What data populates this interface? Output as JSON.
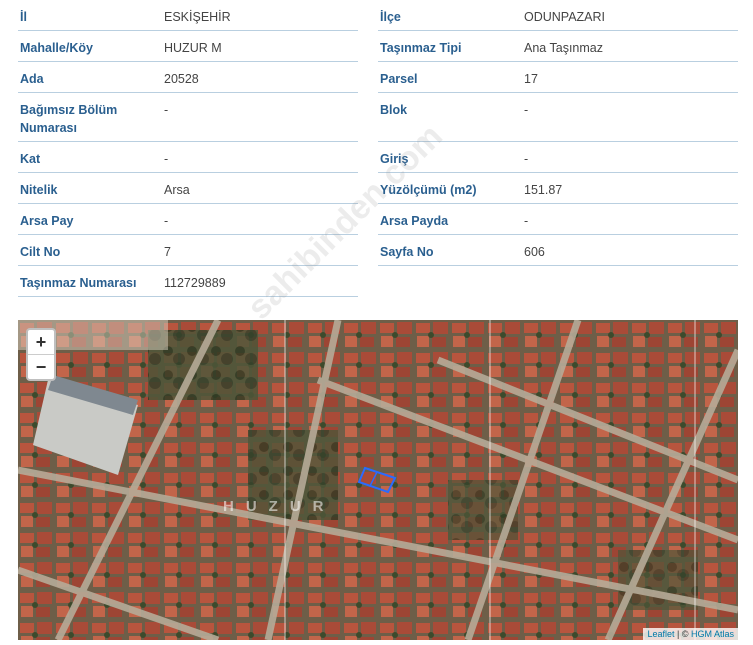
{
  "rows": [
    {
      "l1": "İl",
      "v1": "ESKİŞEHİR",
      "l2": "İlçe",
      "v2": "ODUNPAZARI"
    },
    {
      "l1": "Mahalle/Köy",
      "v1": "HUZUR M",
      "l2": "Taşınmaz Tipi",
      "v2": "Ana Taşınmaz"
    },
    {
      "l1": "Ada",
      "v1": "20528",
      "l2": "Parsel",
      "v2": "17"
    },
    {
      "l1": "Bağımsız Bölüm Numarası",
      "v1": "-",
      "l2": "Blok",
      "v2": "-"
    },
    {
      "l1": "Kat",
      "v1": "-",
      "l2": "Giriş",
      "v2": "-"
    },
    {
      "l1": "Nitelik",
      "v1": "Arsa",
      "l2": "Yüzölçümü (m2)",
      "v2": "151.87"
    },
    {
      "l1": "Arsa Pay",
      "v1": "-",
      "l2": "Arsa Payda",
      "v2": "-"
    },
    {
      "l1": "Cilt No",
      "v1": "7",
      "l2": "Sayfa No",
      "v2": "606"
    },
    {
      "l1": "Taşınmaz Numarası",
      "v1": "112729889",
      "l2": "",
      "v2": ""
    }
  ],
  "map": {
    "zoom_in": "+",
    "zoom_out": "−",
    "area_label": "HUZUR",
    "attribution_leaflet": "Leaflet",
    "attribution_sep": " | © ",
    "attribution_source": "HGM Atlas"
  },
  "watermark": "sahibinden.com"
}
